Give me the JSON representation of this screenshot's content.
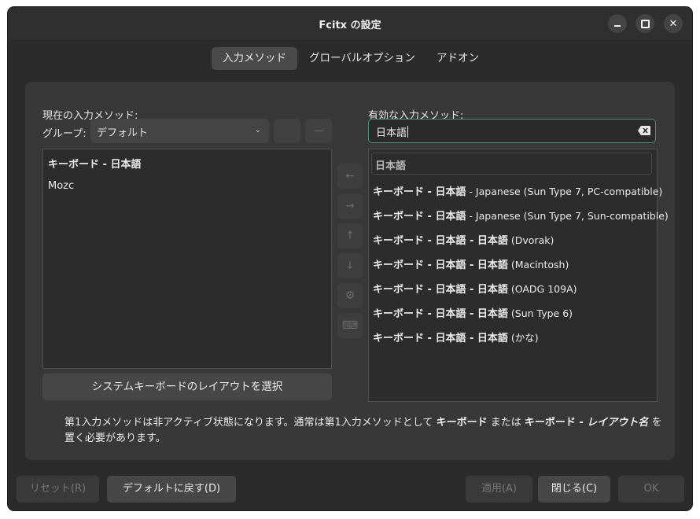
{
  "window": {
    "title": "Fcitx の設定"
  },
  "tabs": [
    {
      "label": "入力メソッド"
    },
    {
      "label": "グローバルオプション"
    },
    {
      "label": "アドオン"
    }
  ],
  "current": {
    "label": "現在の入力メソッド:",
    "group_label": "グループ:",
    "group_value": "デフォルト",
    "items": [
      "キーボード - 日本語",
      "Mozc"
    ],
    "layout_button": "システムキーボードのレイアウトを選択"
  },
  "available": {
    "label": "有効な入力メソッド:",
    "search_value": "日本語",
    "header": "日本語",
    "items": [
      {
        "bold": "キーボード - 日本語",
        "rest": " - Japanese (Sun Type 7, PC-compatible)"
      },
      {
        "bold": "キーボード - 日本語",
        "rest": " - Japanese (Sun Type 7, Sun-compatible)"
      },
      {
        "bold": "キーボード - 日本語 - 日本語",
        "rest": " (Dvorak)"
      },
      {
        "bold": "キーボード - 日本語 - 日本語",
        "rest": " (Macintosh)"
      },
      {
        "bold": "キーボード - 日本語 - 日本語",
        "rest": " (OADG 109A)"
      },
      {
        "bold": "キーボード - 日本語 - 日本語",
        "rest": " (Sun Type 6)"
      },
      {
        "bold": "キーボード - 日本語 - 日本語",
        "rest": " (かな)"
      }
    ]
  },
  "note": {
    "part1": "第1入力メソッドは非アクティブ状態になります。通常は第1入力メソッドとして ",
    "bold1": "キーボード",
    "part2": " または ",
    "bold2": "キーボード - ",
    "italic": "レイアウト名",
    "part3": " を置く必要があります。"
  },
  "buttons": {
    "reset": "リセット(R)",
    "defaults": "デフォルトに戻す(D)",
    "apply": "適用(A)",
    "close": "閉じる(C)",
    "ok": "OK"
  },
  "icons": {
    "minimize": "minimize-icon",
    "maximize": "maximize-icon",
    "close": "close-icon",
    "chevron": "chevron-down-icon",
    "clear": "clear-text-icon",
    "left": "arrow-left-icon",
    "right": "arrow-right-icon",
    "up": "arrow-up-icon",
    "down": "arrow-down-icon",
    "settings": "gear-icon",
    "keyboard": "keyboard-icon"
  },
  "colors": {
    "accent": "#4f8f7e",
    "window_bg": "#2b2b2b",
    "panel_bg": "#383838"
  }
}
